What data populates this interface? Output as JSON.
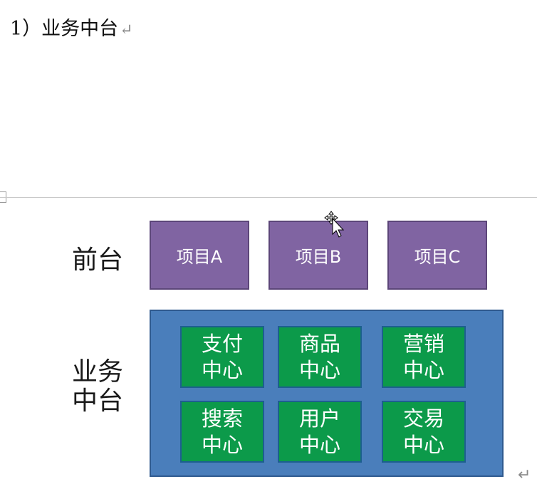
{
  "heading": {
    "text": "1）业务中台",
    "mark": "↵"
  },
  "layers": {
    "front": {
      "label": "前台"
    },
    "middle": {
      "label_line1": "业务",
      "label_line2": "中台"
    }
  },
  "projects": [
    "项目A",
    "项目B",
    "项目C"
  ],
  "services": [
    {
      "line1": "支付",
      "line2": "中心"
    },
    {
      "line1": "商品",
      "line2": "中心"
    },
    {
      "line1": "营销",
      "line2": "中心"
    },
    {
      "line1": "搜索",
      "line2": "中心"
    },
    {
      "line1": "用户",
      "line2": "中心"
    },
    {
      "line1": "交易",
      "line2": "中心"
    }
  ],
  "end_mark": "↵",
  "colors": {
    "project": "#8064a2",
    "platform": "#4a7ebb",
    "service": "#0c9a4a"
  },
  "icons": {
    "cursor": "move-cursor-icon",
    "paragraph": "paragraph-return-icon"
  }
}
